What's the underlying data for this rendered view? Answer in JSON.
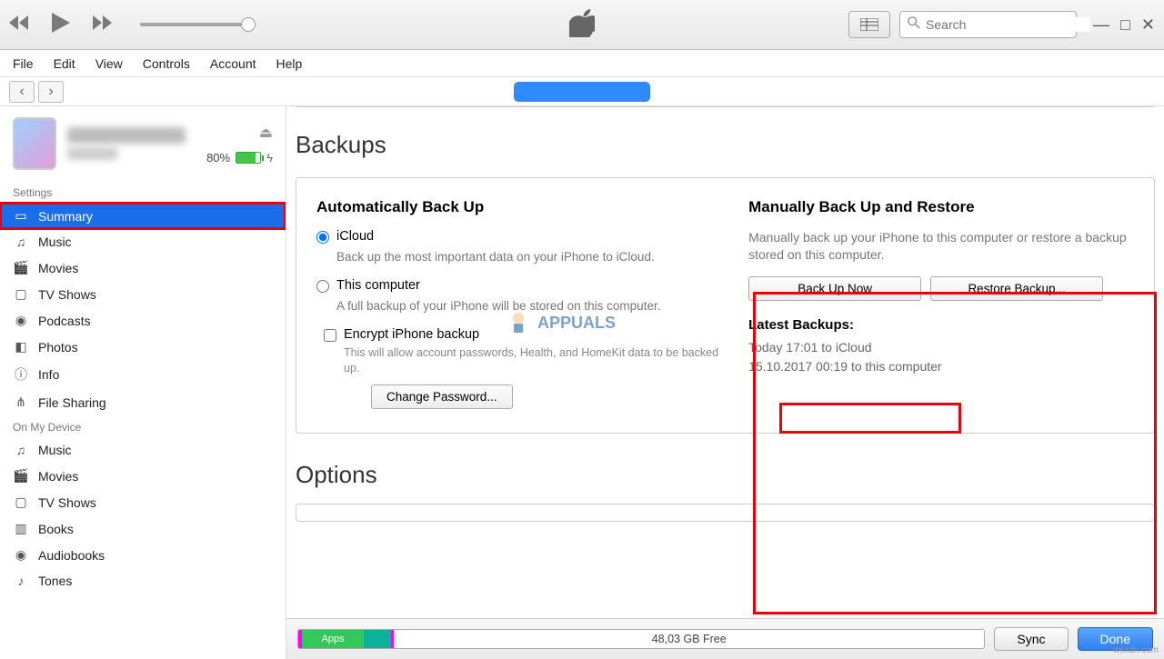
{
  "toolbar": {
    "search_placeholder": "Search"
  },
  "menu": [
    "File",
    "Edit",
    "View",
    "Controls",
    "Account",
    "Help"
  ],
  "device": {
    "battery_pct": "80%"
  },
  "sidebar": {
    "settings_title": "Settings",
    "settings_items": [
      "Summary",
      "Music",
      "Movies",
      "TV Shows",
      "Podcasts",
      "Photos",
      "Info",
      "File Sharing"
    ],
    "device_title": "On My Device",
    "device_items": [
      "Music",
      "Movies",
      "TV Shows",
      "Books",
      "Audiobooks",
      "Tones"
    ]
  },
  "content": {
    "backups_title": "Backups",
    "auto_h": "Automatically Back Up",
    "icloud_label": "iCloud",
    "icloud_desc": "Back up the most important data on your iPhone to iCloud.",
    "thispc_label": "This computer",
    "thispc_desc": "A full backup of your iPhone will be stored on this computer.",
    "encrypt_label": "Encrypt iPhone backup",
    "encrypt_desc": "This will allow account passwords, Health, and HomeKit data to be backed up.",
    "change_pw": "Change Password...",
    "manual_h": "Manually Back Up and Restore",
    "manual_desc": "Manually back up your iPhone to this computer or restore a backup stored on this computer.",
    "backup_now": "Back Up Now",
    "restore": "Restore Backup...",
    "latest_h": "Latest Backups:",
    "latest_1": "Today 17:01 to iCloud",
    "latest_2": "15.10.2017 00:19 to this computer",
    "options_title": "Options"
  },
  "bottom": {
    "apps_label": "Apps",
    "free_label": "48,03 GB Free",
    "sync": "Sync",
    "done": "Done"
  },
  "watermark": "APPUALS",
  "footer_credit": "wsxdn.com"
}
